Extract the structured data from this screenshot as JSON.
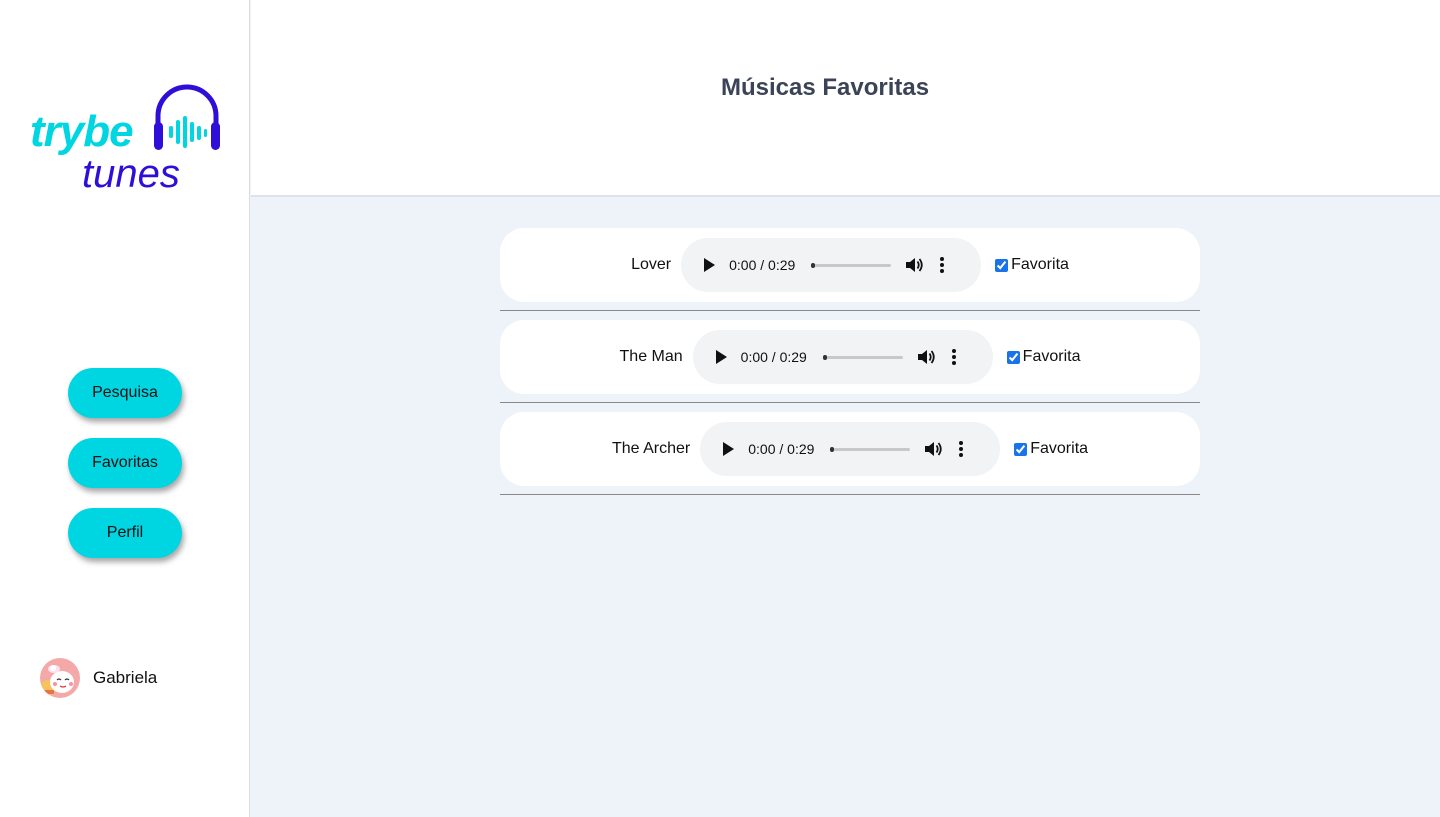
{
  "logo": {
    "word1": "trybe",
    "word2": "tunes"
  },
  "sidebar": {
    "nav": [
      {
        "label": "Pesquisa"
      },
      {
        "label": "Favoritas"
      },
      {
        "label": "Perfil"
      }
    ],
    "user": {
      "name": "Gabriela"
    }
  },
  "header": {
    "title": "Músicas Favoritas"
  },
  "tracks": [
    {
      "name": "Lover",
      "time": "0:00 / 0:29",
      "favorite_label": "Favorita",
      "favorite_checked": true
    },
    {
      "name": "The Man",
      "time": "0:00 / 0:29",
      "favorite_label": "Favorita",
      "favorite_checked": true
    },
    {
      "name": "The Archer",
      "time": "0:00 / 0:29",
      "favorite_label": "Favorita",
      "favorite_checked": true
    }
  ],
  "colors": {
    "accent_cyan": "#00d5e2",
    "brand_blue": "#2f0fd8",
    "title_text": "#3b4356",
    "page_bg": "#eef2f9"
  }
}
